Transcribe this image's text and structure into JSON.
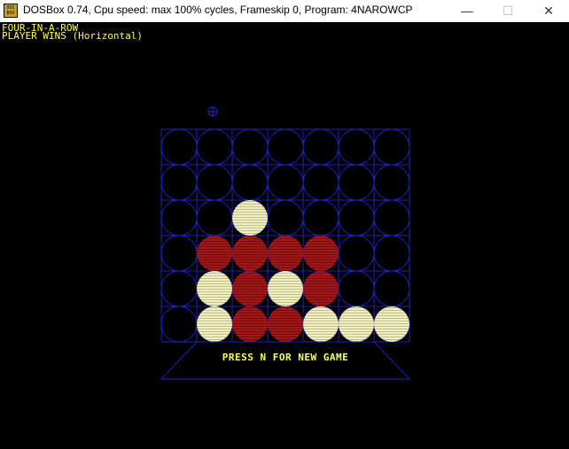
{
  "window": {
    "title": "DOSBox 0.74, Cpu speed: max 100% cycles, Frameskip  0, Program: 4NAROWCP",
    "icon": "dosbox-icon",
    "icon_text_top": "DOS",
    "icon_text_bottom": "BOX",
    "minimize_glyph": "—",
    "maximize_glyph": "☐",
    "close_glyph": "✕"
  },
  "game": {
    "title": "FOUR-IN-A-ROW",
    "status": "PLAYER WINS (Horizontal)",
    "prompt": "PRESS N FOR NEW GAME",
    "selector_column": 1,
    "colors": {
      "grid": "#2020c0",
      "player": "#ffff99",
      "computer": "#a01010",
      "text": "#ffff55"
    },
    "board": [
      [
        0,
        0,
        0,
        0,
        0,
        0,
        0
      ],
      [
        0,
        0,
        0,
        0,
        0,
        0,
        0
      ],
      [
        0,
        0,
        1,
        0,
        0,
        0,
        0
      ],
      [
        0,
        2,
        2,
        2,
        2,
        0,
        0
      ],
      [
        0,
        1,
        2,
        1,
        2,
        0,
        0
      ],
      [
        0,
        1,
        2,
        2,
        1,
        1,
        1
      ]
    ]
  }
}
